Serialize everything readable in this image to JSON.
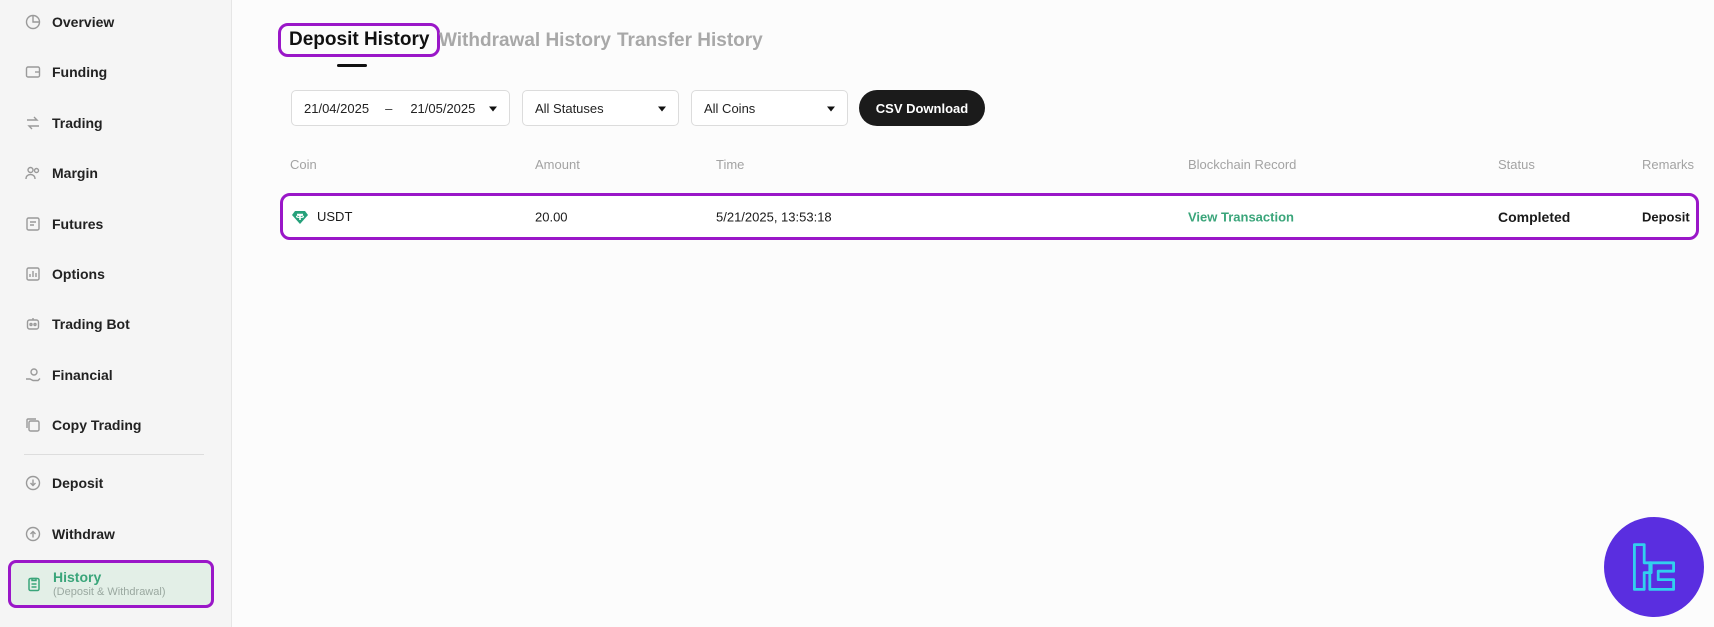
{
  "sidebar": {
    "items": [
      {
        "label": "Overview",
        "icon": "pie-chart-icon"
      },
      {
        "label": "Funding",
        "icon": "wallet-icon"
      },
      {
        "label": "Trading",
        "icon": "exchange-icon"
      },
      {
        "label": "Margin",
        "icon": "users-icon"
      },
      {
        "label": "Futures",
        "icon": "futures-icon"
      },
      {
        "label": "Options",
        "icon": "options-icon"
      },
      {
        "label": "Trading Bot",
        "icon": "bot-icon"
      },
      {
        "label": "Financial",
        "icon": "hand-coin-icon"
      },
      {
        "label": "Copy Trading",
        "icon": "copy-icon"
      },
      {
        "label": "Deposit",
        "icon": "arrow-down-icon"
      },
      {
        "label": "Withdraw",
        "icon": "arrow-up-icon"
      }
    ],
    "active": {
      "label": "History",
      "sublabel": "(Deposit & Withdrawal)",
      "icon": "clipboard-icon"
    }
  },
  "tabs": [
    {
      "label": "Deposit History",
      "active": true
    },
    {
      "label": "Withdrawal History",
      "active": false
    },
    {
      "label": "Transfer History",
      "active": false
    }
  ],
  "filters": {
    "date_from": "21/04/2025",
    "date_sep": "–",
    "date_to": "21/05/2025",
    "status": "All Statuses",
    "coin": "All Coins",
    "csv_label": "CSV Download"
  },
  "table": {
    "headers": [
      "Coin",
      "Amount",
      "Time",
      "Blockchain Record",
      "Status",
      "Remarks"
    ],
    "rows": [
      {
        "coin": "USDT",
        "amount": "20.00",
        "time": "5/21/2025, 13:53:18",
        "record": "View Transaction",
        "status": "Completed",
        "remarks": "Deposit"
      }
    ]
  },
  "colors": {
    "accent": "#3aa57a",
    "highlight": "#9a17c8",
    "usdt": "#26a17b",
    "logo_bg": "#5a2ee0",
    "logo_fg": "#31d0ee"
  }
}
